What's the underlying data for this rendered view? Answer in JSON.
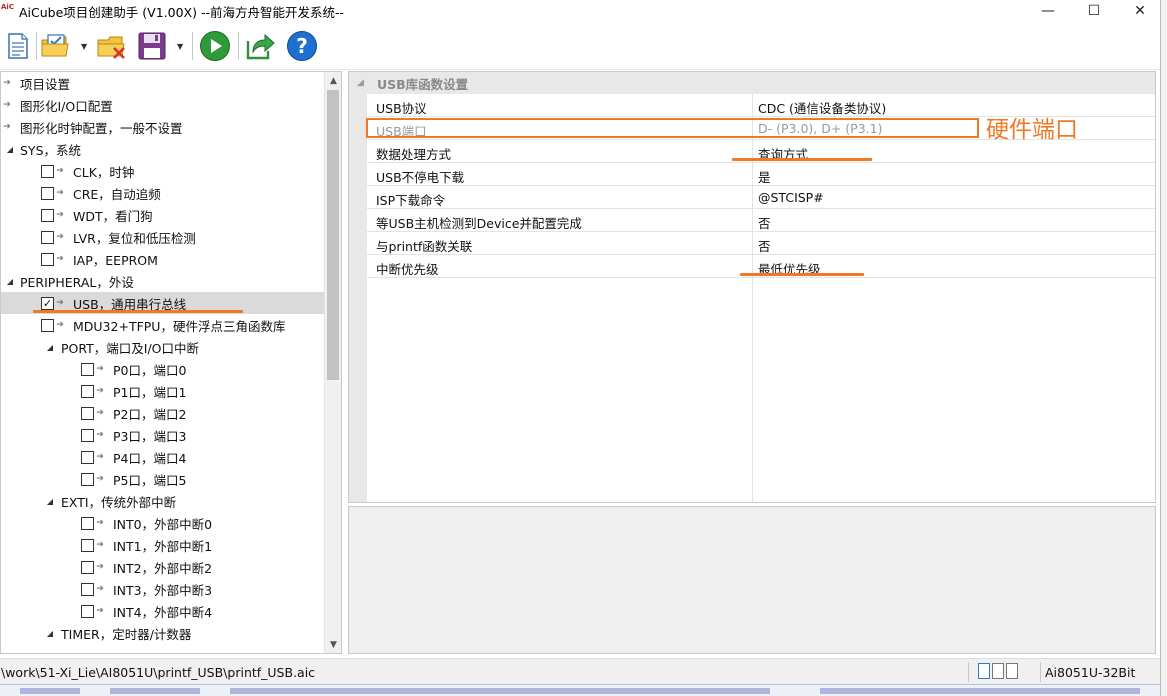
{
  "window": {
    "title": "AiCube项目创建助手 (V1.00X) --前海方舟智能开发系统--",
    "logo_text": "AiC",
    "controls": {
      "minimize": "—",
      "maximize": "☐",
      "close": "✕"
    }
  },
  "toolbar": {
    "buttons": [
      {
        "name": "new-project",
        "icon": "document-icon"
      },
      {
        "name": "open-project",
        "icon": "folder-check-icon"
      },
      {
        "name": "close-project",
        "icon": "folder-delete-icon"
      },
      {
        "name": "save-project",
        "icon": "floppy-disk-icon"
      },
      {
        "name": "run",
        "icon": "play-icon"
      },
      {
        "name": "export",
        "icon": "share-arrow-icon"
      },
      {
        "name": "help",
        "icon": "help-icon"
      }
    ]
  },
  "tree": {
    "items": [
      {
        "label": "项目设置",
        "level": 0,
        "checkbox": false,
        "expander": ""
      },
      {
        "label": "图形化I/O口配置",
        "level": 0,
        "checkbox": false,
        "expander": ""
      },
      {
        "label": "图形化时钟配置，一般不设置",
        "level": 0,
        "checkbox": false,
        "expander": ""
      },
      {
        "label": "SYS，系统",
        "level": 0,
        "checkbox": false,
        "expander": "◢"
      },
      {
        "label": "CLK，时钟",
        "level": 1,
        "checkbox": true,
        "checked": false
      },
      {
        "label": "CRE，自动追频",
        "level": 1,
        "checkbox": true,
        "checked": false
      },
      {
        "label": "WDT，看门狗",
        "level": 1,
        "checkbox": true,
        "checked": false
      },
      {
        "label": "LVR，复位和低压检测",
        "level": 1,
        "checkbox": true,
        "checked": false
      },
      {
        "label": "IAP，EEPROM",
        "level": 1,
        "checkbox": true,
        "checked": false
      },
      {
        "label": "PERIPHERAL，外设",
        "level": 0,
        "checkbox": false,
        "expander": "◢"
      },
      {
        "label": "USB，通用串行总线",
        "level": 1,
        "checkbox": true,
        "checked": true,
        "selected": true
      },
      {
        "label": "MDU32+TFPU，硬件浮点三角函数库",
        "level": 1,
        "checkbox": true,
        "checked": false
      },
      {
        "label": "PORT，端口及I/O口中断",
        "level": 1,
        "checkbox": false,
        "expander": "◢"
      },
      {
        "label": "P0口，端口0",
        "level": 2,
        "checkbox": true,
        "checked": false
      },
      {
        "label": "P1口，端口1",
        "level": 2,
        "checkbox": true,
        "checked": false
      },
      {
        "label": "P2口，端口2",
        "level": 2,
        "checkbox": true,
        "checked": false
      },
      {
        "label": "P3口，端口3",
        "level": 2,
        "checkbox": true,
        "checked": false
      },
      {
        "label": "P4口，端口4",
        "level": 2,
        "checkbox": true,
        "checked": false
      },
      {
        "label": "P5口，端口5",
        "level": 2,
        "checkbox": true,
        "checked": false
      },
      {
        "label": "EXTI，传统外部中断",
        "level": 1,
        "checkbox": false,
        "expander": "◢"
      },
      {
        "label": "INT0，外部中断0",
        "level": 2,
        "checkbox": true,
        "checked": false
      },
      {
        "label": "INT1，外部中断1",
        "level": 2,
        "checkbox": true,
        "checked": false
      },
      {
        "label": "INT2，外部中断2",
        "level": 2,
        "checkbox": true,
        "checked": false
      },
      {
        "label": "INT3，外部中断3",
        "level": 2,
        "checkbox": true,
        "checked": false
      },
      {
        "label": "INT4，外部中断4",
        "level": 2,
        "checkbox": true,
        "checked": false
      },
      {
        "label": "TIMER，定时器/计数器",
        "level": 1,
        "checkbox": false,
        "expander": "◢"
      }
    ]
  },
  "properties": {
    "section_title": "USB库函数设置",
    "collapse_glyph": "◢",
    "rows": [
      {
        "name": "USB协议",
        "value": "CDC (通信设备类协议)",
        "disabled": false
      },
      {
        "name": "USB端口",
        "value": "D- (P3.0), D+ (P3.1)",
        "disabled": true
      },
      {
        "name": "数据处理方式",
        "value": "查询方式",
        "disabled": false
      },
      {
        "name": "USB不停电下载",
        "value": "是",
        "disabled": false
      },
      {
        "name": "ISP下载命令",
        "value": "@STCISP#",
        "disabled": false
      },
      {
        "name": "等USB主机检测到Device并配置完成",
        "value": "否",
        "disabled": false
      },
      {
        "name": "与printf函数关联",
        "value": "否",
        "disabled": false
      },
      {
        "name": "中断优先级",
        "value": "最低优先级",
        "disabled": false
      }
    ]
  },
  "annotation": {
    "label": "硬件端口",
    "color": "#ee7a25"
  },
  "statusbar": {
    "path": "\\work\\51-Xi_Lie\\AI8051U\\printf_USB\\printf_USB.aic",
    "chip": "Ai8051U-32Bit"
  },
  "colors": {
    "selection": "#dadada",
    "accent": "#ee7a25",
    "header": "#e8e8e8"
  }
}
